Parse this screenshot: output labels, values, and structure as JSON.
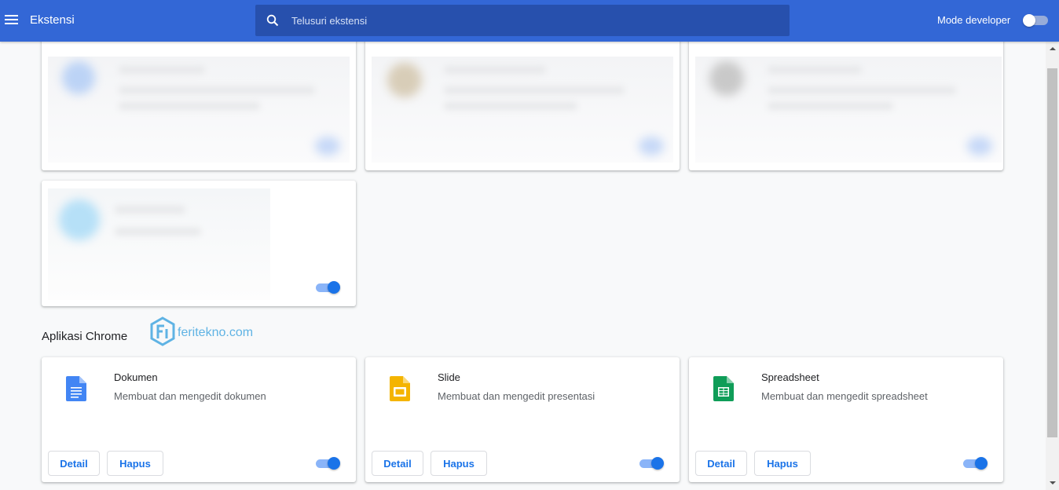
{
  "header": {
    "title": "Ekstensi",
    "search_placeholder": "Telusuri ekstensi",
    "dev_mode_label": "Mode developer",
    "dev_mode_enabled": false
  },
  "extensions_enabled": [
    true,
    true,
    true,
    true
  ],
  "apps_section": {
    "title": "Aplikasi Chrome",
    "watermark": "feritekno.com",
    "apps": [
      {
        "name": "Dokumen",
        "description": "Membuat dan mengedit dokumen",
        "detail_label": "Detail",
        "remove_label": "Hapus",
        "enabled": true,
        "icon": "google-docs-icon",
        "color": "#4285f4"
      },
      {
        "name": "Slide",
        "description": "Membuat dan mengedit presentasi",
        "detail_label": "Detail",
        "remove_label": "Hapus",
        "enabled": true,
        "icon": "google-slides-icon",
        "color": "#f4b400"
      },
      {
        "name": "Spreadsheet",
        "description": "Membuat dan mengedit spreadsheet",
        "detail_label": "Detail",
        "remove_label": "Hapus",
        "enabled": true,
        "icon": "google-sheets-icon",
        "color": "#0f9d58"
      }
    ]
  },
  "colors": {
    "header": "#3367d6",
    "accent": "#1a73e8"
  }
}
